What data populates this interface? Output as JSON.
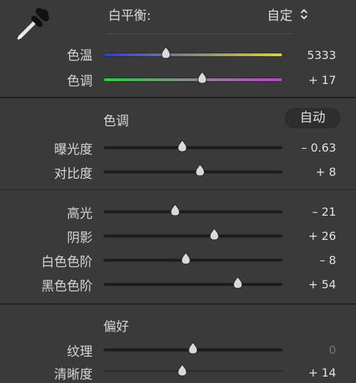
{
  "white_balance": {
    "label": "白平衡:",
    "value": "自定",
    "sliders": [
      {
        "label": "色温",
        "value": "5333",
        "position": 0.35
      },
      {
        "label": "色调",
        "value": "+ 17",
        "position": 0.55
      }
    ]
  },
  "tone": {
    "title": "色调",
    "auto_label": "自动",
    "sliders_a": [
      {
        "label": "曝光度",
        "value": "– 0.63",
        "position": 0.44
      },
      {
        "label": "对比度",
        "value": "+ 8",
        "position": 0.54
      }
    ],
    "sliders_b": [
      {
        "label": "高光",
        "value": "– 21",
        "position": 0.4
      },
      {
        "label": "阴影",
        "value": "+ 26",
        "position": 0.62
      },
      {
        "label": "白色色阶",
        "value": "– 8",
        "position": 0.46
      },
      {
        "label": "黑色色阶",
        "value": "+ 54",
        "position": 0.75
      }
    ]
  },
  "presence": {
    "title": "偏好",
    "sliders": [
      {
        "label": "纹理",
        "value": "0",
        "position": 0.5
      },
      {
        "label": "清晰度",
        "value": "+ 14",
        "position": 0.44
      }
    ]
  },
  "colors": {
    "temp_gradient": [
      "#2f3bd3",
      "#8a8a7a",
      "#d8d63a"
    ],
    "tint_gradient": [
      "#2fcf3a",
      "#8a8a8a",
      "#c13fd0"
    ]
  }
}
